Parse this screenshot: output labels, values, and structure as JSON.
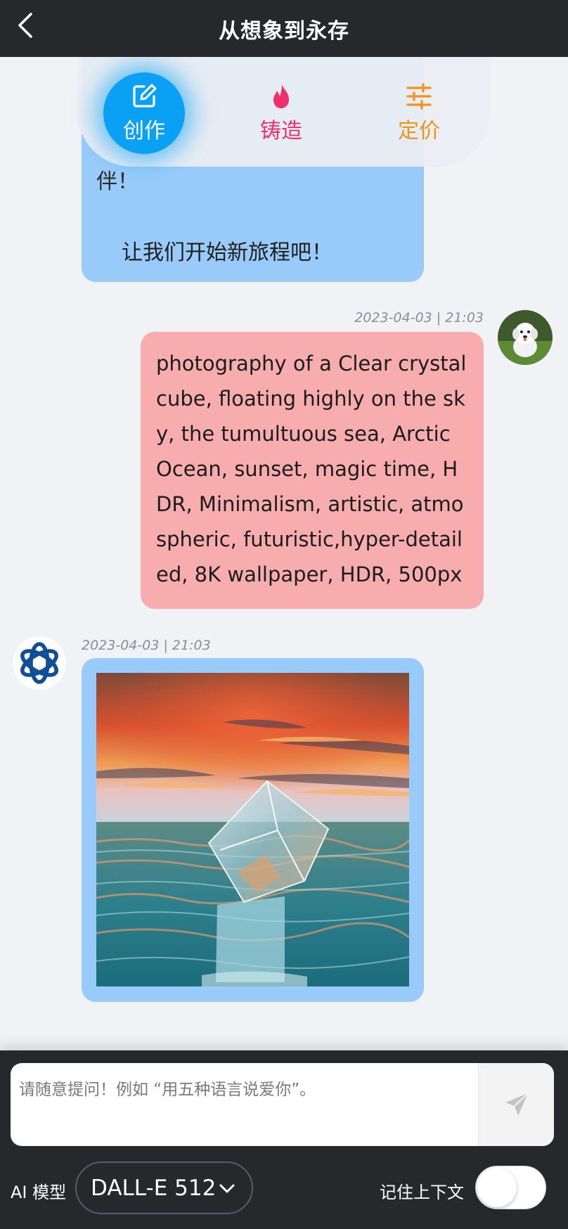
{
  "header": {
    "title": "从想象到永存"
  },
  "action_bar": {
    "create_label": "创作",
    "forge_label": "铸造",
    "price_label": "定价",
    "active": "create"
  },
  "messages": [
    {
      "role": "ai",
      "lines": [
        "伴！",
        "让我们开始新旅程吧！"
      ]
    },
    {
      "role": "user",
      "time": "2023-04-03 | 21:03",
      "text": "photography of a Clear crystal cube, floating highly on the sky, the tumultuous sea, Arctic Ocean, sunset, magic time, HDR, Minimalism, artistic, atmospheric, futuristic,hyper-detailed, 8K wallpaper, HDR, 500px"
    },
    {
      "role": "ai",
      "time": "2023-04-03 | 21:03",
      "content": "image"
    }
  ],
  "footer": {
    "input_placeholder": "请随意提问！例如 “用五种语言说爱你”。",
    "model_label": "AI 模型",
    "model_value": "DALL-E 512",
    "context_label": "记住上下文",
    "context_enabled": false
  },
  "colors": {
    "header_bg": "#27282c",
    "ai_bubble": "#99cbfa",
    "user_bubble": "#f7adad",
    "create_accent": "#0aa1f4",
    "forge_accent": "#f0306b",
    "price_accent": "#f09419",
    "ai_logo": "#0e4f98"
  }
}
